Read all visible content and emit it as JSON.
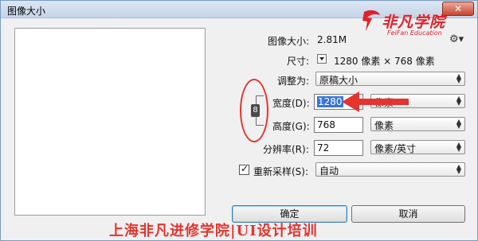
{
  "window": {
    "title": "图像大小",
    "close_label": "✕"
  },
  "brand": {
    "name": "非凡学院",
    "subtitle": "FeiFan Education"
  },
  "image_size": {
    "label": "图像大小:",
    "value": "2.81M"
  },
  "dimensions": {
    "label": "尺寸:",
    "value": "1280 像素 × 768 像素"
  },
  "fit_to": {
    "label": "调整为:",
    "value": "原稿大小"
  },
  "width": {
    "label": "宽度(D):",
    "value": "1280",
    "unit": "像素"
  },
  "height": {
    "label": "高度(G):",
    "value": "768",
    "unit": "像素"
  },
  "resolution": {
    "label": "分辨率(R):",
    "value": "72",
    "unit": "像素/英寸"
  },
  "resample": {
    "label": "重新采样(S):",
    "value": "自动",
    "checked": true
  },
  "buttons": {
    "ok": "确定",
    "cancel": "取消"
  },
  "watermark": "上海非凡进修学院|UI设计培训",
  "icons": {
    "settings": "gear-icon",
    "link": "chain-link-icon",
    "close": "close-icon"
  },
  "colors": {
    "annotation_red": "#e3342f",
    "brand_red": "#e0212b",
    "selection_blue": "#3875d7"
  }
}
